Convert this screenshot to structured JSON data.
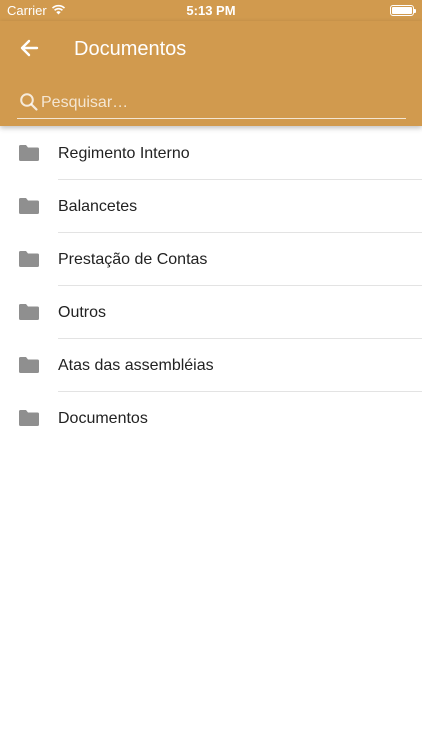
{
  "status_bar": {
    "carrier": "Carrier",
    "time": "5:13 PM",
    "icons": [
      "wifi-icon",
      "battery-icon"
    ]
  },
  "header": {
    "title": "Documentos",
    "back_icon": "arrow-left-icon",
    "background_color": "#d19a4e"
  },
  "search": {
    "placeholder": "Pesquisar…",
    "value": "",
    "icon": "search-icon"
  },
  "documents": {
    "icon": "folder-icon",
    "icon_color": "#8f8f8f",
    "items": [
      {
        "label": "Regimento Interno"
      },
      {
        "label": "Balancetes"
      },
      {
        "label": "Prestação de Contas"
      },
      {
        "label": "Outros"
      },
      {
        "label": "Atas das assembléias"
      },
      {
        "label": "Documentos"
      }
    ]
  }
}
